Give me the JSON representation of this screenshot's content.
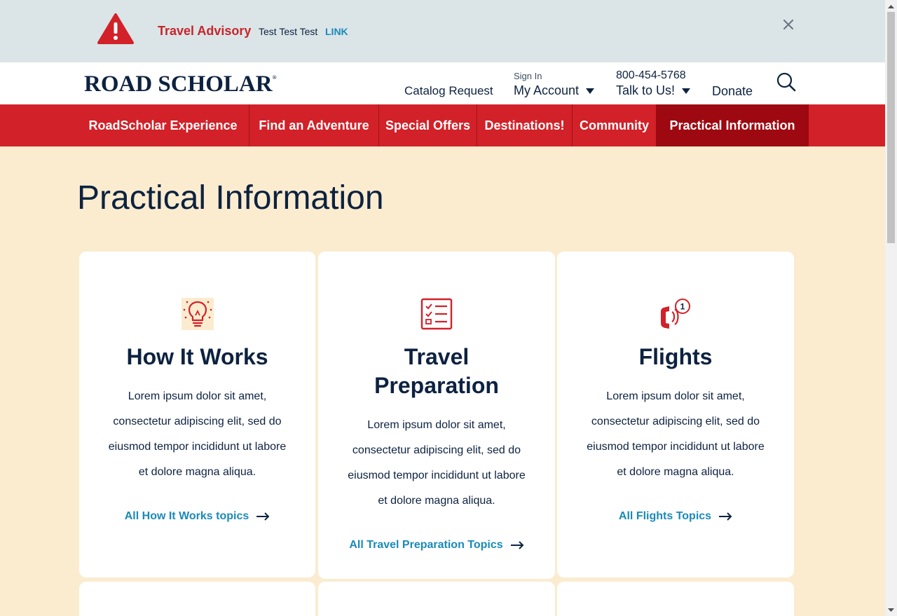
{
  "advisory": {
    "title": "Travel Advisory",
    "text": "Test Test Test",
    "link": "LINK"
  },
  "header": {
    "logo": "ROAD SCHOLAR",
    "logo_mark": "®",
    "catalog": "Catalog Request",
    "signin": "Sign In",
    "account": "My Account",
    "phone": "800-454-5768",
    "talk": "Talk to Us!",
    "donate": "Donate"
  },
  "nav": [
    {
      "label": "RoadScholar Experience"
    },
    {
      "label": "Find an Adventure"
    },
    {
      "label": "Special Offers"
    },
    {
      "label": "Destinations!"
    },
    {
      "label": "Community"
    },
    {
      "label": "Practical Information"
    }
  ],
  "page": {
    "title": "Practical Information"
  },
  "cards": [
    {
      "title": "How It Works",
      "desc": "Lorem ipsum dolor sit amet, consectetur adipiscing elit, sed do eiusmod tempor incididunt ut labore et dolore magna aliqua.",
      "link": "All How It Works topics",
      "icon": "lightbulb-icon"
    },
    {
      "title": "Travel Preparation",
      "desc": "Lorem ipsum dolor sit amet, consectetur adipiscing elit, sed do eiusmod tempor incididunt ut labore et dolore magna aliqua.",
      "link": "All Travel Preparation Topics",
      "icon": "checklist-icon"
    },
    {
      "title": "Flights",
      "desc": "Lorem ipsum dolor sit amet, consectetur adipiscing elit, sed do eiusmod tempor incididunt ut labore et dolore magna aliqua.",
      "link": "All Flights Topics",
      "icon": "phone-call-icon"
    }
  ],
  "colors": {
    "brand_red": "#d22128",
    "active_nav": "#9e0810",
    "navy": "#0d2240",
    "link_blue": "#1a8ab8",
    "page_bg": "#fbecd0",
    "advisory_bg": "#dbe5e7"
  }
}
